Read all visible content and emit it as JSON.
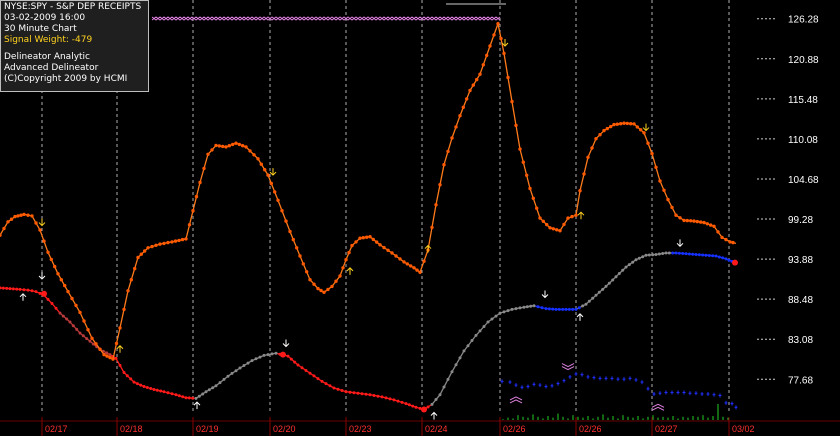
{
  "info": {
    "symbol": "NYSE:SPY - S&P DEP RECEIPTS",
    "datetime": "03-02-2009  16:00",
    "interval": "30 Minute Chart",
    "signal_weight": "Signal Weight: -479",
    "analytic": "Delineator Analytic",
    "advanced": "Advanced Delineator",
    "copyright": "(C)Copyright 2009 by  HCMI"
  },
  "colors": {
    "background": "#000000",
    "price_line": "#ff7a1a",
    "price_dots": "#ff5a00",
    "delineator_red": "#ff1a1a",
    "delineator_dark_red": "#b83a3a",
    "delineator_gray": "#8a8a8a",
    "delineator_blue": "#1530ff",
    "lower_blue": "#2030ff",
    "axis_text": "#ffffff",
    "date_text": "#ff3030",
    "grid": "#cfcfcf",
    "volume": "#1fae1f",
    "arrow_yellow": "#ffd21f",
    "arrow_white": "#ffffff",
    "chevron": "#e080e0"
  },
  "chart_data": {
    "type": "line",
    "ylim": [
      73.0,
      128.8
    ],
    "y_ticks": [
      126.28,
      120.88,
      115.48,
      110.08,
      104.68,
      99.28,
      93.88,
      88.48,
      83.08,
      77.68
    ],
    "x_ticks": [
      "02/17",
      "02/18",
      "02/19",
      "02/20",
      "02/23",
      "02/24",
      "02/26",
      "02/26",
      "02/27",
      "03/02"
    ],
    "series": [
      {
        "style": "price",
        "points": [
          [
            0,
            97.1
          ],
          [
            8,
            98.9
          ],
          [
            15,
            99.6
          ],
          [
            24,
            99.9
          ],
          [
            32,
            99.7
          ],
          [
            40,
            97.8
          ],
          [
            48,
            94.8
          ],
          [
            58,
            91.9
          ],
          [
            68,
            89.5
          ],
          [
            80,
            86.7
          ],
          [
            92,
            83.2
          ],
          [
            104,
            81.0
          ],
          [
            113,
            80.4
          ],
          [
            120,
            84.6
          ],
          [
            128,
            89.6
          ],
          [
            138,
            94.1
          ],
          [
            148,
            95.4
          ],
          [
            160,
            95.9
          ],
          [
            172,
            96.2
          ],
          [
            186,
            96.6
          ],
          [
            200,
            104.2
          ],
          [
            208,
            108.0
          ],
          [
            216,
            109.2
          ],
          [
            226,
            109.0
          ],
          [
            236,
            109.5
          ],
          [
            246,
            109.0
          ],
          [
            258,
            107.4
          ],
          [
            268,
            105.2
          ],
          [
            278,
            101.8
          ],
          [
            290,
            97.6
          ],
          [
            300,
            94.3
          ],
          [
            310,
            91.1
          ],
          [
            318,
            89.9
          ],
          [
            324,
            89.4
          ],
          [
            332,
            90.2
          ],
          [
            340,
            91.6
          ],
          [
            346,
            93.8
          ],
          [
            352,
            95.7
          ],
          [
            360,
            96.7
          ],
          [
            370,
            96.9
          ],
          [
            380,
            95.8
          ],
          [
            392,
            94.7
          ],
          [
            404,
            93.5
          ],
          [
            414,
            92.7
          ],
          [
            420,
            92.1
          ],
          [
            428,
            95.1
          ],
          [
            436,
            101.2
          ],
          [
            444,
            106.6
          ],
          [
            452,
            110.2
          ],
          [
            460,
            113.2
          ],
          [
            470,
            116.6
          ],
          [
            480,
            118.8
          ],
          [
            490,
            122.6
          ],
          [
            498,
            125.6
          ],
          [
            504,
            121.6
          ],
          [
            512,
            115.1
          ],
          [
            520,
            108.7
          ],
          [
            530,
            103.4
          ],
          [
            540,
            99.4
          ],
          [
            550,
            98.1
          ],
          [
            560,
            97.7
          ],
          [
            568,
            99.4
          ],
          [
            576,
            99.8
          ],
          [
            580,
            103.1
          ],
          [
            588,
            107.6
          ],
          [
            596,
            110.1
          ],
          [
            604,
            111.2
          ],
          [
            614,
            112.0
          ],
          [
            624,
            112.2
          ],
          [
            634,
            112.1
          ],
          [
            644,
            110.9
          ],
          [
            652,
            108.1
          ],
          [
            660,
            104.4
          ],
          [
            668,
            101.9
          ],
          [
            676,
            99.8
          ],
          [
            684,
            99.1
          ],
          [
            694,
            99.0
          ],
          [
            704,
            98.8
          ],
          [
            714,
            98.3
          ],
          [
            722,
            96.8
          ],
          [
            730,
            96.2
          ],
          [
            736,
            96.0
          ]
        ]
      },
      {
        "style": "delineator",
        "points": [
          [
            0,
            90.0
          ],
          [
            10,
            89.9
          ],
          [
            20,
            89.8
          ],
          [
            28,
            89.7
          ],
          [
            36,
            89.5
          ],
          [
            44,
            89.0
          ],
          [
            52,
            87.9
          ],
          [
            60,
            86.6
          ],
          [
            70,
            85.4
          ],
          [
            80,
            83.9
          ],
          [
            90,
            82.8
          ],
          [
            100,
            81.7
          ],
          [
            110,
            81.0
          ],
          [
            116,
            80.5
          ],
          [
            124,
            78.6
          ],
          [
            134,
            77.3
          ],
          [
            144,
            76.7
          ],
          [
            154,
            76.3
          ],
          [
            164,
            76.0
          ],
          [
            176,
            75.6
          ],
          [
            186,
            75.2
          ],
          [
            196,
            75.1
          ],
          [
            206,
            76.0
          ],
          [
            216,
            76.8
          ],
          [
            228,
            78.1
          ],
          [
            240,
            79.2
          ],
          [
            252,
            80.2
          ],
          [
            264,
            80.9
          ],
          [
            276,
            81.2
          ],
          [
            288,
            80.8
          ],
          [
            298,
            79.6
          ],
          [
            310,
            78.5
          ],
          [
            322,
            77.4
          ],
          [
            334,
            76.5
          ],
          [
            346,
            76.0
          ],
          [
            358,
            75.8
          ],
          [
            370,
            75.6
          ],
          [
            382,
            75.3
          ],
          [
            394,
            74.9
          ],
          [
            406,
            74.4
          ],
          [
            416,
            73.9
          ],
          [
            424,
            73.6
          ],
          [
            432,
            74.3
          ],
          [
            440,
            75.6
          ],
          [
            452,
            78.7
          ],
          [
            464,
            81.5
          ],
          [
            476,
            83.6
          ],
          [
            488,
            85.4
          ],
          [
            500,
            86.6
          ],
          [
            512,
            87.1
          ],
          [
            524,
            87.4
          ],
          [
            534,
            87.6
          ],
          [
            546,
            87.2
          ],
          [
            556,
            87.1
          ],
          [
            566,
            87.1
          ],
          [
            576,
            87.1
          ],
          [
            586,
            87.8
          ],
          [
            596,
            89.0
          ],
          [
            606,
            90.2
          ],
          [
            616,
            91.5
          ],
          [
            626,
            92.8
          ],
          [
            636,
            93.8
          ],
          [
            646,
            94.4
          ],
          [
            656,
            94.5
          ],
          [
            666,
            94.7
          ],
          [
            676,
            94.7
          ],
          [
            686,
            94.6
          ],
          [
            696,
            94.5
          ],
          [
            706,
            94.4
          ],
          [
            716,
            94.3
          ],
          [
            726,
            93.9
          ],
          [
            735,
            93.4
          ]
        ]
      },
      {
        "style": "lower",
        "points": [
          [
            502,
            77.4
          ],
          [
            510,
            77.3
          ],
          [
            516,
            76.9
          ],
          [
            522,
            76.6
          ],
          [
            528,
            76.7
          ],
          [
            534,
            77.0
          ],
          [
            540,
            76.9
          ],
          [
            546,
            76.7
          ],
          [
            552,
            76.8
          ],
          [
            558,
            77.1
          ],
          [
            564,
            77.5
          ],
          [
            570,
            78.0
          ],
          [
            576,
            78.4
          ],
          [
            582,
            78.3
          ],
          [
            588,
            78.0
          ],
          [
            594,
            77.9
          ],
          [
            600,
            77.8
          ],
          [
            606,
            77.8
          ],
          [
            612,
            77.8
          ],
          [
            618,
            77.7
          ],
          [
            624,
            77.7
          ],
          [
            630,
            77.8
          ],
          [
            636,
            77.6
          ],
          [
            642,
            77.3
          ],
          [
            648,
            76.4
          ],
          [
            654,
            75.7
          ],
          [
            660,
            75.8
          ],
          [
            666,
            75.9
          ],
          [
            672,
            75.9
          ],
          [
            678,
            75.9
          ],
          [
            684,
            75.9
          ],
          [
            690,
            75.8
          ],
          [
            696,
            75.8
          ],
          [
            702,
            75.7
          ],
          [
            708,
            75.7
          ],
          [
            714,
            75.6
          ],
          [
            720,
            75.5
          ],
          [
            726,
            74.5
          ],
          [
            732,
            74.4
          ],
          [
            736,
            73.9
          ]
        ]
      }
    ],
    "signals": [
      {
        "type": "down",
        "color": "yellow",
        "x": 42,
        "y": 98.4
      },
      {
        "type": "up",
        "color": "yellow",
        "x": 120,
        "y": 82.2
      },
      {
        "type": "down",
        "color": "yellow",
        "x": 273,
        "y": 105.2
      },
      {
        "type": "up",
        "color": "yellow",
        "x": 350,
        "y": 92.7
      },
      {
        "type": "up",
        "color": "yellow",
        "x": 428,
        "y": 95.7
      },
      {
        "type": "down",
        "color": "yellow",
        "x": 505,
        "y": 122.6
      },
      {
        "type": "up",
        "color": "yellow",
        "x": 581,
        "y": 100.2
      },
      {
        "type": "down",
        "color": "yellow",
        "x": 646,
        "y": 111.2
      },
      {
        "type": "up",
        "color": "white",
        "x": 23,
        "y": 89.2
      },
      {
        "type": "down",
        "color": "white",
        "x": 42,
        "y": 91.2
      },
      {
        "type": "up",
        "color": "white",
        "x": 197,
        "y": 74.6
      },
      {
        "type": "down",
        "color": "white",
        "x": 286,
        "y": 82.1
      },
      {
        "type": "up",
        "color": "white",
        "x": 434,
        "y": 73.2
      },
      {
        "type": "down",
        "color": "white",
        "x": 545,
        "y": 88.7
      },
      {
        "type": "up",
        "color": "white",
        "x": 580,
        "y": 86.5
      },
      {
        "type": "down",
        "color": "white",
        "x": 680,
        "y": 95.6
      }
    ],
    "chevrons": [
      {
        "dir": "up",
        "x": 516,
        "y": 75.3
      },
      {
        "dir": "down",
        "x": 568,
        "y": 79.8
      },
      {
        "dir": "up",
        "x": 658,
        "y": 74.3
      }
    ],
    "volume": [
      [
        503,
        1
      ],
      [
        508,
        3
      ],
      [
        513,
        2
      ],
      [
        518,
        6
      ],
      [
        523,
        4
      ],
      [
        528,
        3
      ],
      [
        533,
        7
      ],
      [
        538,
        4
      ],
      [
        543,
        2
      ],
      [
        548,
        5
      ],
      [
        553,
        3
      ],
      [
        558,
        8
      ],
      [
        563,
        4
      ],
      [
        568,
        2
      ],
      [
        573,
        6
      ],
      [
        578,
        4
      ],
      [
        583,
        3
      ],
      [
        588,
        5
      ],
      [
        593,
        2
      ],
      [
        598,
        4
      ],
      [
        603,
        7
      ],
      [
        608,
        3
      ],
      [
        613,
        5
      ],
      [
        618,
        2
      ],
      [
        623,
        6
      ],
      [
        628,
        4
      ],
      [
        633,
        3
      ],
      [
        638,
        5
      ],
      [
        643,
        2
      ],
      [
        648,
        4
      ],
      [
        653,
        6
      ],
      [
        658,
        3
      ],
      [
        663,
        4
      ],
      [
        668,
        3
      ],
      [
        673,
        5
      ],
      [
        678,
        2
      ],
      [
        683,
        4
      ],
      [
        688,
        3
      ],
      [
        693,
        5
      ],
      [
        698,
        4
      ],
      [
        703,
        6
      ],
      [
        708,
        3
      ],
      [
        713,
        5
      ],
      [
        718,
        20
      ],
      [
        723,
        4
      ],
      [
        728,
        3
      ]
    ]
  }
}
